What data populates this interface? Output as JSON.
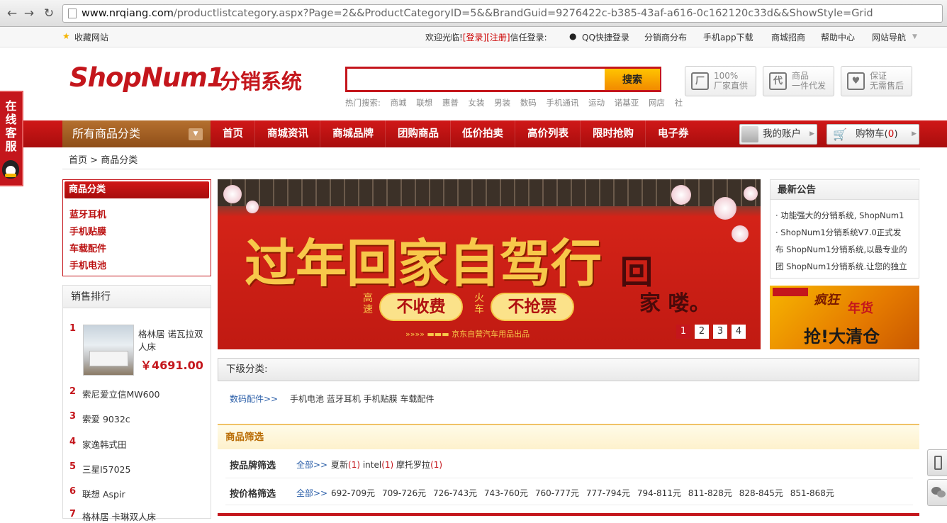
{
  "browser": {
    "url_host": "www.nrqiang.com",
    "url_path": "/productlistcategory.aspx?Page=2&&ProductCategoryID=5&&BrandGuid=9276422c-b385-43af-a616-0c162120c33d&&ShowStyle=Grid"
  },
  "topbar": {
    "favorite": "收藏网站",
    "welcome": "欢迎光临!",
    "login": "[登录]",
    "register": "[注册]",
    "trust_login": "信任登录:",
    "qq_login": "QQ快捷登录",
    "links": [
      "分销商分布",
      "手机app下载",
      "商城招商",
      "帮助中心",
      "网站导航"
    ]
  },
  "header": {
    "logo_text": "ShopNum1",
    "logo_sub": "分销系统",
    "search_placeholder": "",
    "search_button": "搜索",
    "hot_label": "热门搜索:",
    "hot_terms": [
      "商城",
      "联想",
      "惠普",
      "女装",
      "男装",
      "数码",
      "手机通讯",
      "运动",
      "诺基亚",
      "网店",
      "社"
    ],
    "features": [
      {
        "icon": "厂",
        "line1": "100%",
        "line2": "厂家直供"
      },
      {
        "icon": "代",
        "line1": "商品",
        "line2": "一件代发"
      },
      {
        "icon": "♥",
        "line1": "保证",
        "line2": "无需售后"
      }
    ]
  },
  "nav": {
    "all_categories": "所有商品分类",
    "items": [
      "首页",
      "商城资讯",
      "商城品牌",
      "团购商品",
      "低价拍卖",
      "高价列表",
      "限时抢购",
      "电子券"
    ],
    "account": "我的账户",
    "cart": "购物车(",
    "cart_count": "0",
    "cart_close": ")"
  },
  "breadcrumb": {
    "home": "首页",
    "sep": ">",
    "current": "商品分类"
  },
  "category_box": {
    "title": "商品分类",
    "items": [
      "蓝牙耳机",
      "手机贴膜",
      "车载配件",
      "手机电池"
    ]
  },
  "ranking": {
    "title": "销售排行",
    "items": [
      {
        "rank": "1",
        "name": "格林居 诺瓦拉双人床",
        "price": "￥4691.00"
      },
      {
        "rank": "2",
        "name": "索尼爱立信MW600"
      },
      {
        "rank": "3",
        "name": "索爱 9032c"
      },
      {
        "rank": "4",
        "name": "家逸韩式田"
      },
      {
        "rank": "5",
        "name": "三星I57025"
      },
      {
        "rank": "6",
        "name": "联想 Aspir"
      },
      {
        "rank": "7",
        "name": "格林居 卡琳双人床"
      }
    ]
  },
  "banner": {
    "title": "过年回家自驾行",
    "sub1": "高速",
    "pill1": "不收费",
    "sub2": "火车",
    "pill2": "不抢票",
    "right1": "回",
    "right2": "家 喽。",
    "footer": "京东自营汽车用品出品",
    "pages": [
      "1",
      "2",
      "3",
      "4"
    ],
    "active_page": "1"
  },
  "notice": {
    "title": "最新公告",
    "lines": [
      "· 功能强大的分销系统, ShopNum1",
      "· ShopNum1分销系统V7.0正式发",
      "布 ShopNum1分销系统,以最专业的",
      "团 ShopNum1分销系统.让您的独立"
    ]
  },
  "side_ad": {
    "text1": "疯狂",
    "text2": "年货",
    "text3": "抢!大清仓"
  },
  "subcategory": {
    "title": "下级分类:",
    "link": "数码配件>>",
    "items": "手机电池 蓝牙耳机 手机贴膜 车载配件"
  },
  "filter": {
    "title": "商品筛选",
    "brand_label": "按品牌筛选",
    "all": "全部>>",
    "brands": [
      {
        "name": "夏新",
        "count": "(1)"
      },
      {
        "name": "intel",
        "count": "(1)"
      },
      {
        "name": "摩托罗拉",
        "count": "(1)"
      }
    ],
    "price_label": "按价格筛选",
    "prices": [
      "692-709元",
      "709-726元",
      "726-743元",
      "743-760元",
      "760-777元",
      "777-794元",
      "794-811元",
      "811-828元",
      "828-845元",
      "851-868元"
    ]
  },
  "side_widget": {
    "kefu": "在线客服"
  },
  "colors": {
    "brand_red": "#c4161c",
    "nav_brown": "#9f5c22",
    "search_orange": "#f7a300"
  }
}
